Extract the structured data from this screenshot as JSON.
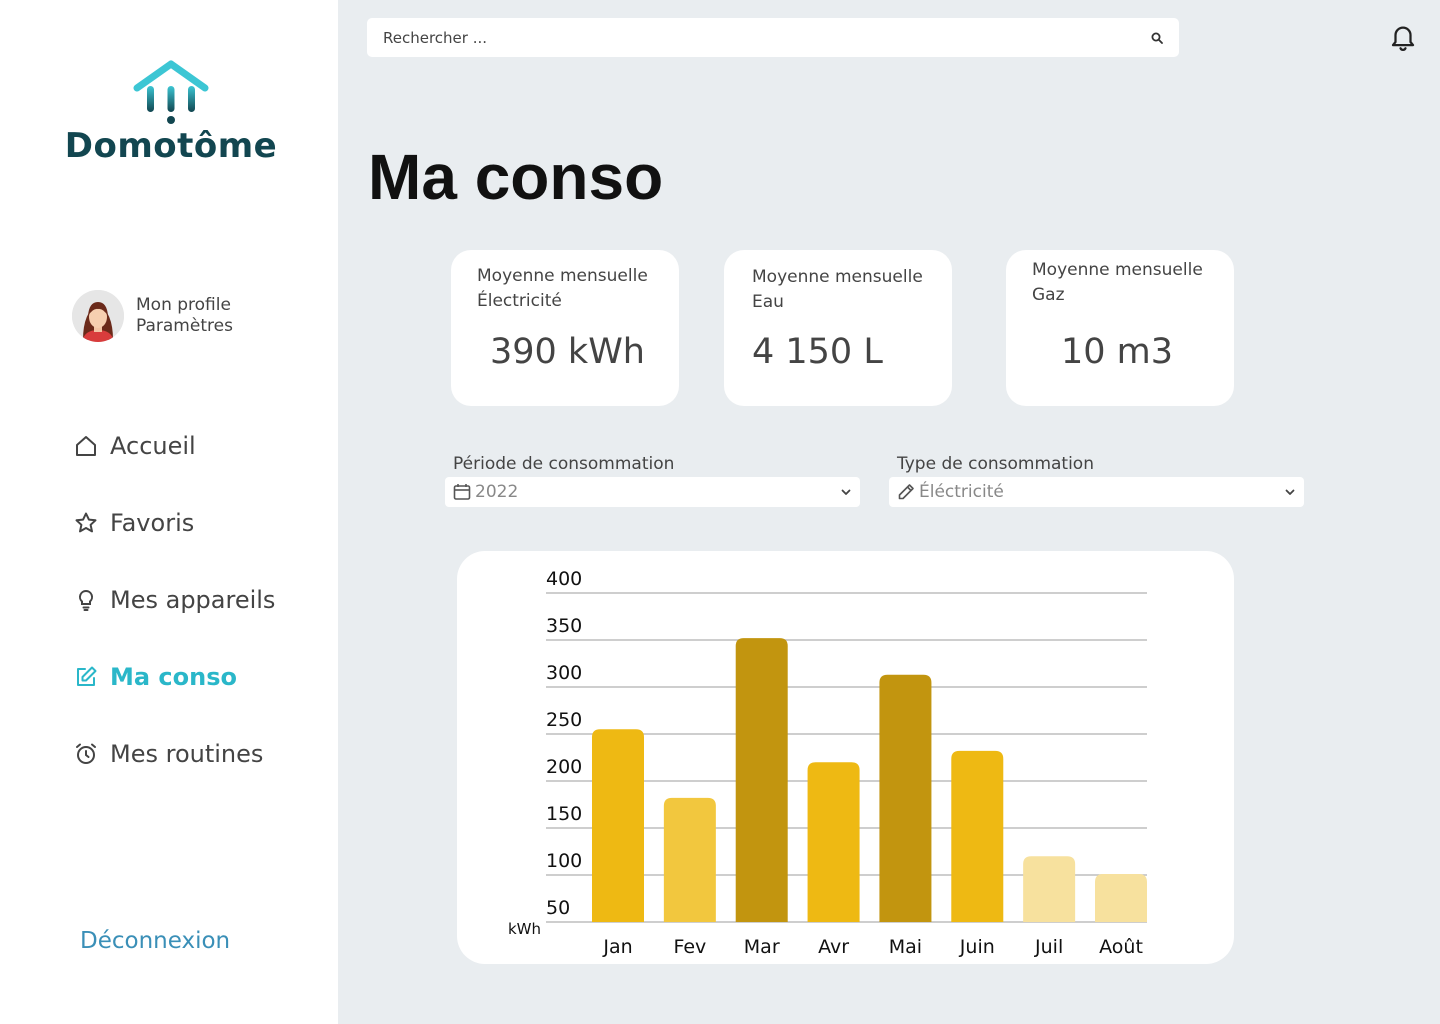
{
  "app": {
    "name": "Domotôme"
  },
  "profile": {
    "line1": "Mon profile",
    "line2": "Paramètres"
  },
  "nav": {
    "items": [
      {
        "label": "Accueil",
        "icon": "home-icon"
      },
      {
        "label": "Favoris",
        "icon": "star-icon"
      },
      {
        "label": "Mes appareils",
        "icon": "lightbulb-icon"
      },
      {
        "label": "Ma conso",
        "icon": "edit-icon",
        "active": true
      },
      {
        "label": "Mes routines",
        "icon": "alarm-clock-icon"
      }
    ],
    "logout": "Déconnexion"
  },
  "search": {
    "placeholder": "Rechercher ..."
  },
  "page": {
    "title": "Ma conso"
  },
  "cards": [
    {
      "label_line1": "Moyenne mensuelle",
      "label_line2": "Électricité",
      "value": "390 kWh"
    },
    {
      "label_line1": "Moyenne mensuelle",
      "label_line2": "Eau",
      "value": "4 150 L"
    },
    {
      "label_line1": "Moyenne mensuelle",
      "label_line2": "Gaz",
      "value": "10 m3"
    }
  ],
  "filters": {
    "period": {
      "label": "Période de consommation",
      "value": "2022"
    },
    "type": {
      "label": "Type de consommation",
      "value": "Éléctricité"
    }
  },
  "colors": {
    "accent": "#2ab7c9",
    "logo": "#124650"
  },
  "chart_data": {
    "type": "bar",
    "categories": [
      "Jan",
      "Fev",
      "Mar",
      "Avr",
      "Mai",
      "Juin",
      "Juil",
      "Août"
    ],
    "values": [
      255,
      182,
      352,
      220,
      313,
      232,
      120,
      101
    ],
    "colors": [
      "#eeb913",
      "#f2c73e",
      "#c2950f",
      "#eeb913",
      "#c2950f",
      "#eeb913",
      "#f7e19e",
      "#f7e19e"
    ],
    "ylabel": "kWh",
    "yticks": [
      50,
      100,
      150,
      200,
      250,
      300,
      350,
      400
    ],
    "ylim": [
      50,
      400
    ],
    "grid": true
  }
}
